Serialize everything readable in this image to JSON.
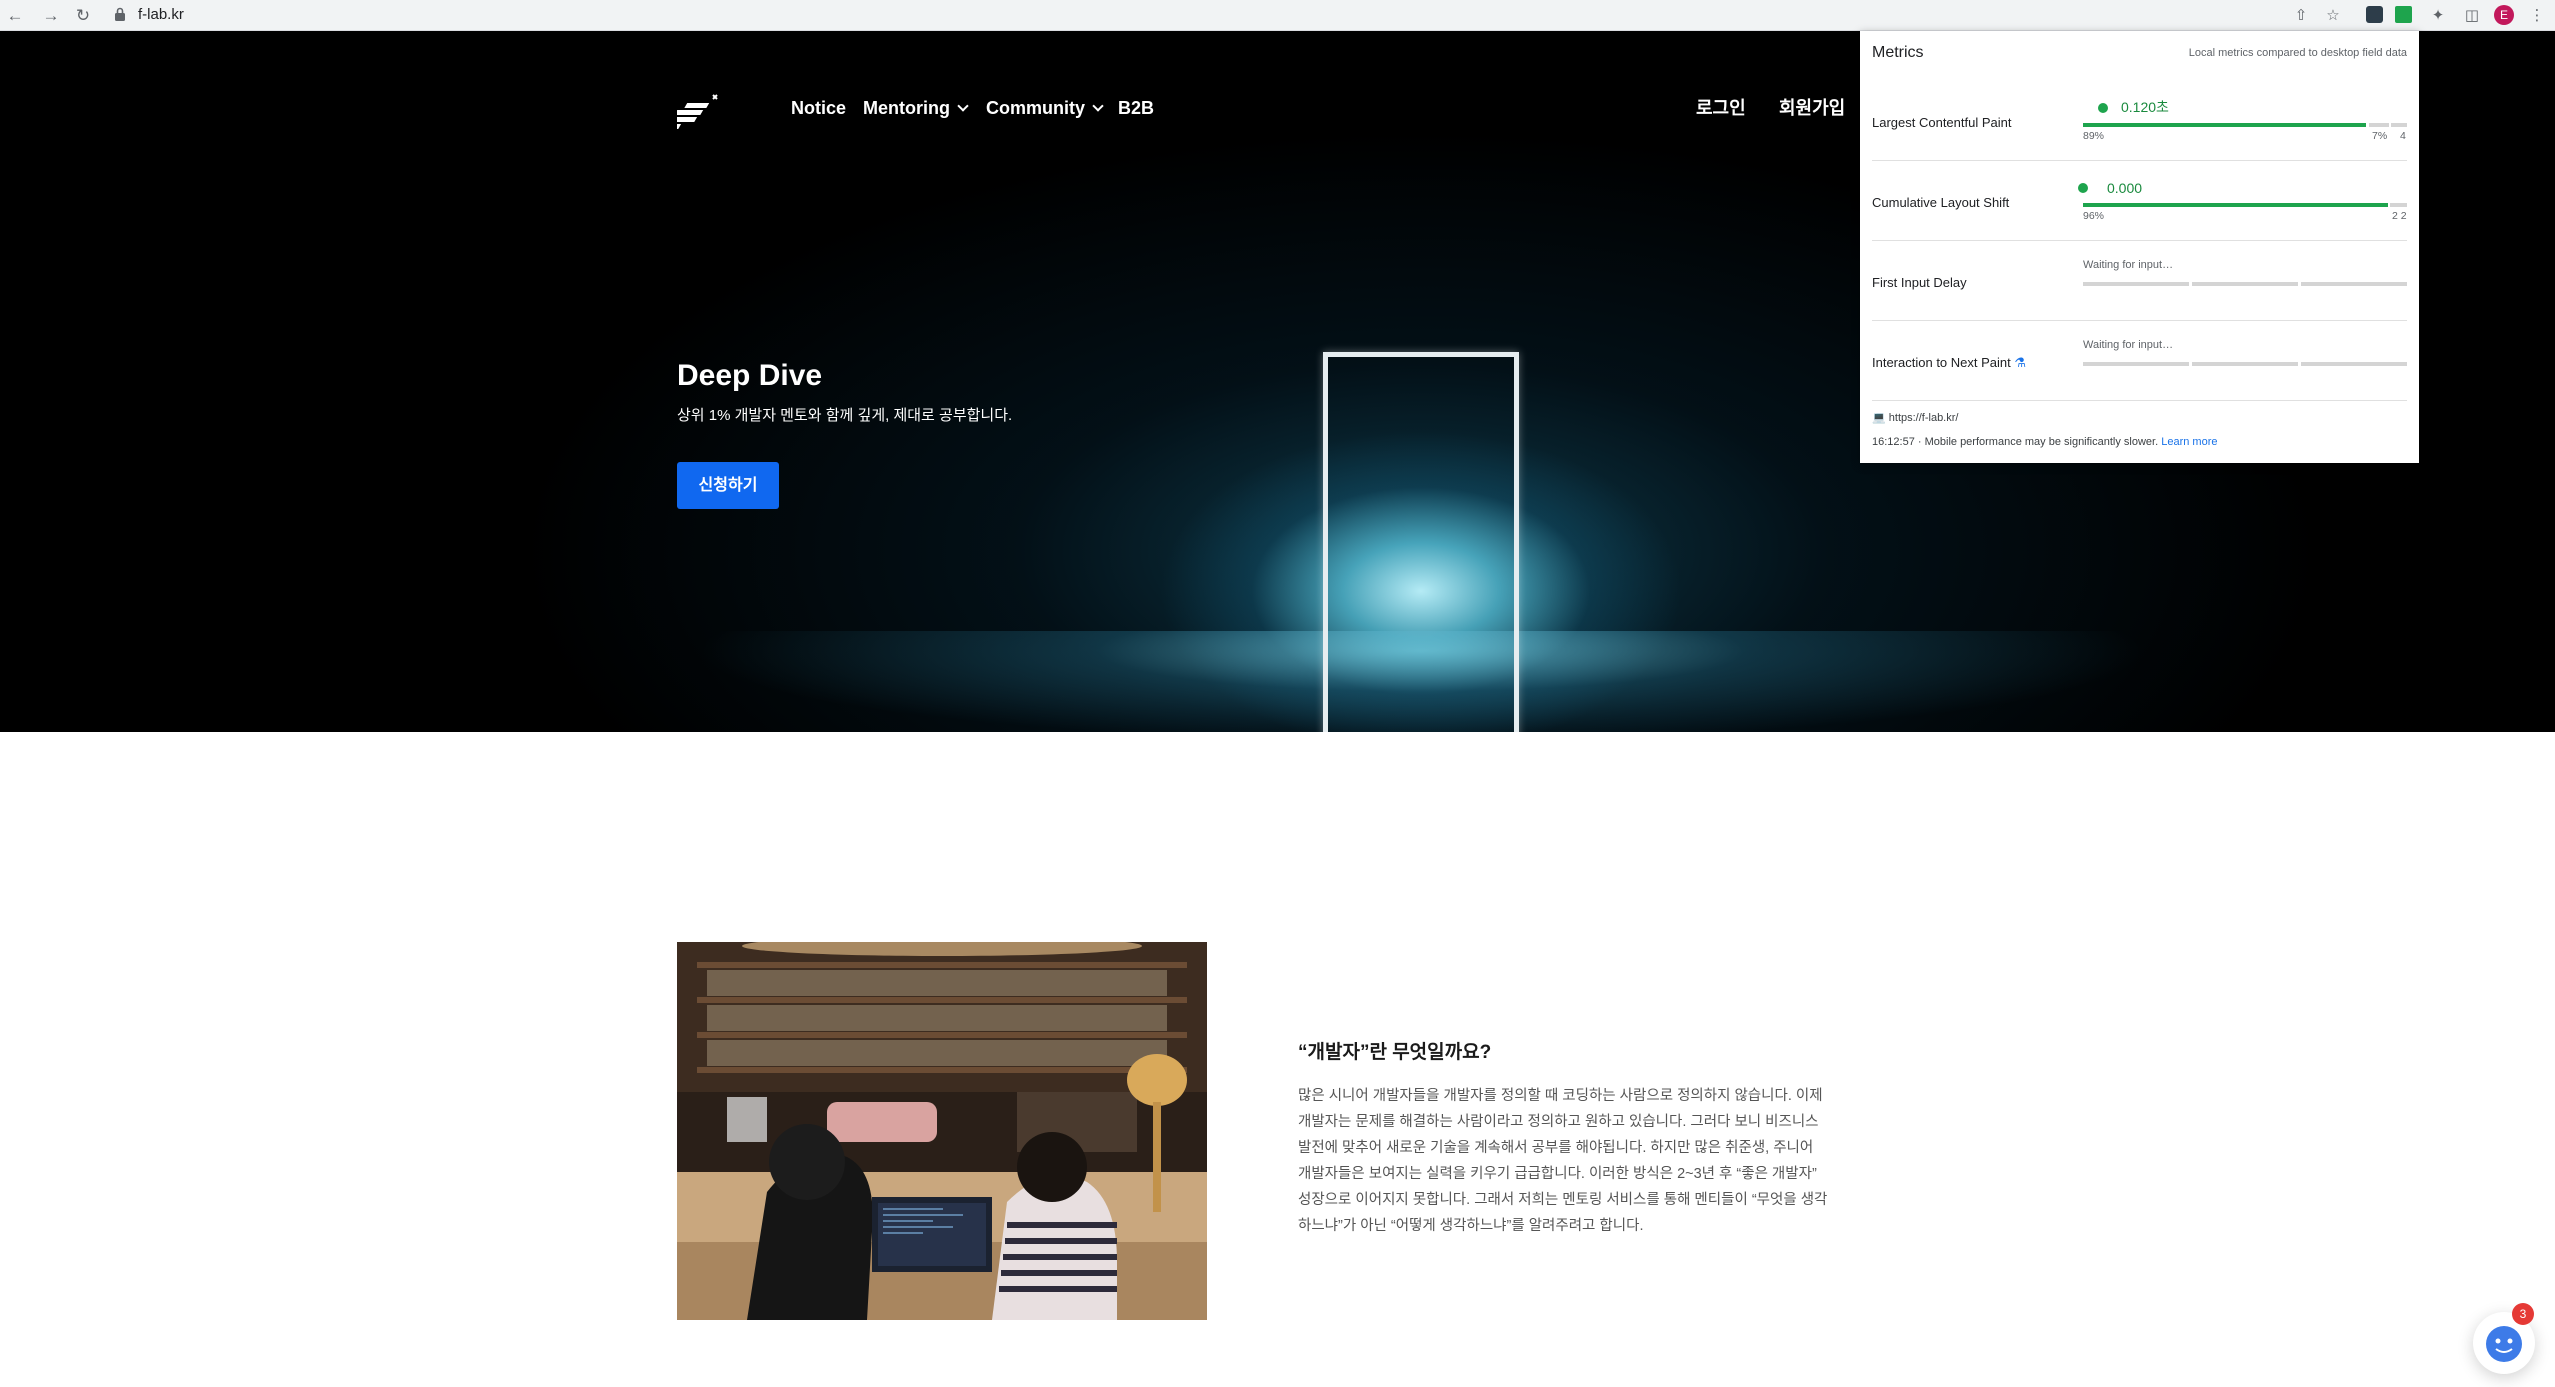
{
  "browser": {
    "url": "f-lab.kr",
    "profile_initial": "E",
    "icons": [
      "back-icon",
      "forward-icon",
      "reload-icon",
      "lock-icon",
      "share-icon",
      "bookmark-star-icon",
      "extension-icon",
      "puzzle-icon",
      "sidepanel-icon",
      "more-icon"
    ]
  },
  "nav": {
    "items": [
      {
        "label": "Notice"
      },
      {
        "label": "Mentoring"
      },
      {
        "label": "Community"
      },
      {
        "label": "B2B"
      }
    ],
    "login": "로그인",
    "signup": "회원가입"
  },
  "hero": {
    "title": "Deep Dive",
    "subtitle": "상위 1% 개발자 멘토와 함께 깊게, 제대로 공부합니다.",
    "cta": "신청하기"
  },
  "intro": {
    "title": "“개발자”란 무엇일까요?",
    "body": "많은 시니어 개발자들을 개발자를 정의할 때 코딩하는 사람으로 정의하지 않습니다. 이제 개발자는 문제를 해결하는 사람이라고 정의하고 원하고 있습니다. 그러다 보니 비즈니스 발전에 맞추어 새로운 기술을 계속해서 공부를 해야됩니다. 하지만 많은 취준생, 주니어 개발자들은 보여지는 실력을 키우기 급급합니다. 이러한 방식은 2~3년 후 “좋은 개발자” 성장으로 이어지지 못합니다. 그래서 저희는 멘토링 서비스를 통해 멘티들이 “무엇을 생각하느냐”가 아닌 “어떻게 생각하느냐”를 알려주려고 합니다."
  },
  "metrics": {
    "title": "Metrics",
    "subtitle": "Local metrics compared to desktop field data",
    "rows": [
      {
        "label": "Largest Contentful Paint",
        "value": "0.120초",
        "pct_good": "89%",
        "pct_mid": "7%",
        "pct_bad": "4"
      },
      {
        "label": "Cumulative Layout Shift",
        "value": "0.000",
        "pct_good": "96%",
        "pct_mid": "",
        "pct_bad": "2 2"
      },
      {
        "label": "First Input Delay",
        "status": "Waiting for input…"
      },
      {
        "label": "Interaction to Next Paint",
        "status": "Waiting for input…"
      }
    ],
    "site": "https://f-lab.kr/",
    "time": "16:12:57",
    "note": "Mobile performance may be significantly slower.",
    "learn_more": "Learn more"
  },
  "chat": {
    "badge": "3"
  },
  "colors": {
    "accent": "#1068f0",
    "good": "#1ea44d",
    "hero_bg": "#000000"
  }
}
